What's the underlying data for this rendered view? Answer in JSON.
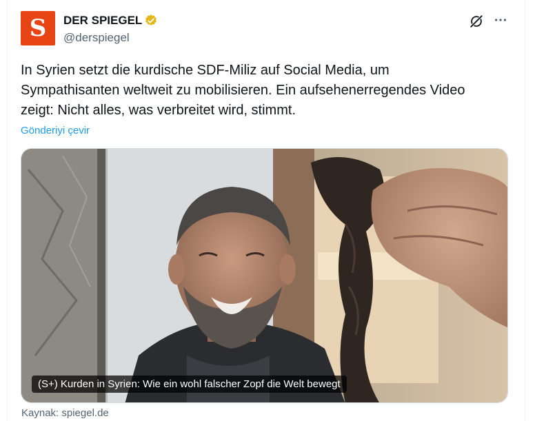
{
  "account": {
    "name": "DER SPIEGEL",
    "handle": "@derspiegel",
    "avatar_letter": "S",
    "avatar_color": "#e64415",
    "verified_badge_color": "#e2b719"
  },
  "tweet": {
    "text": "In Syrien setzt die kurdische SDF-Miliz auf Social Media, um\nSympathisanten weltweit zu mobilisieren. Ein aufsehenerregendes Video\nzeigt: Nicht alles, was verbreitet wird, stimmt.",
    "translate_label": "Gönderiyi çevir"
  },
  "media": {
    "caption": "(S+) Kurden in Syrien: Wie ein wohl falscher Zopf die Welt bewegt"
  },
  "source": {
    "label": "Kaynak: spiegel.de"
  },
  "icons": {
    "grok": "grok-icon",
    "more": "more-options-icon",
    "verified": "verified-badge-icon"
  },
  "colors": {
    "text": "#0f1419",
    "secondary": "#536471",
    "link": "#1d9bf0"
  }
}
